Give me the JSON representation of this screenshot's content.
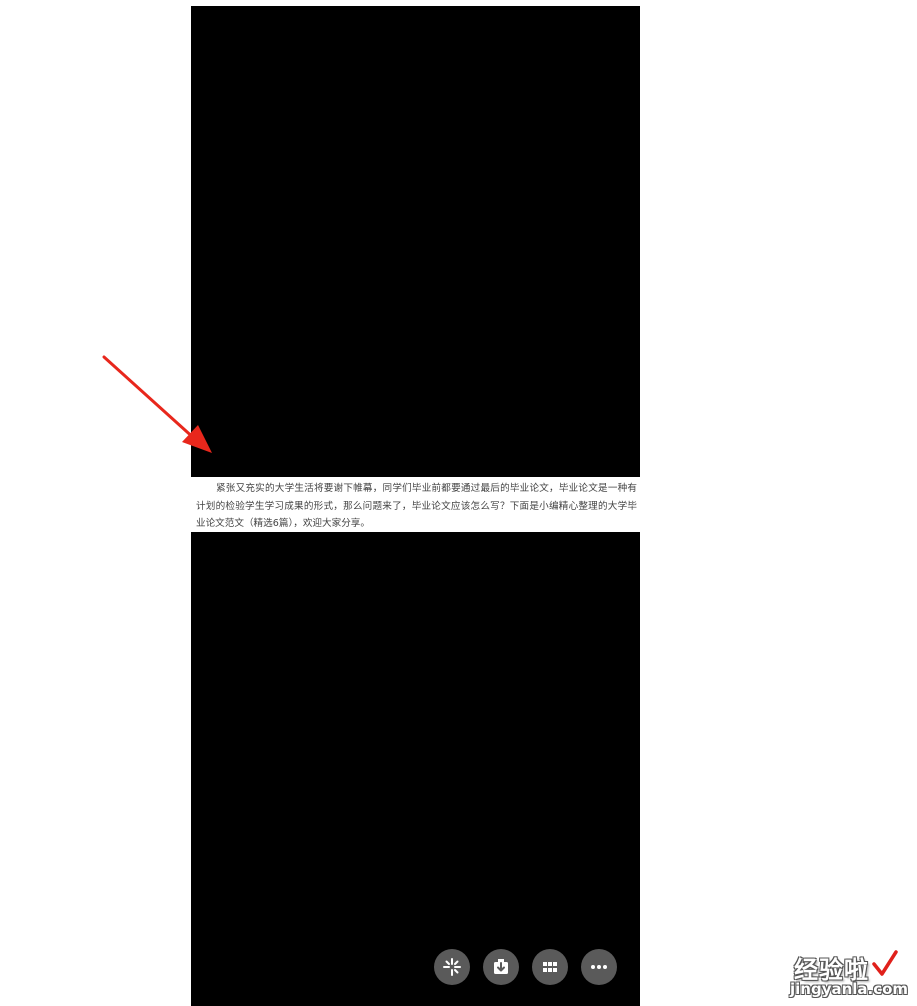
{
  "article": {
    "paragraph": "紧张又充实的大学生活将要谢下帷幕，同学们毕业前都要通过最后的毕业论文，毕业论文是一种有计划的检验学生学习成果的形式，那么问题来了，毕业论文应该怎么写？下面是小编精心整理的大学毕业论文范文（精选6篇），欢迎大家分享。"
  },
  "toolbar": {
    "buttons": [
      {
        "icon": "sparkle-icon"
      },
      {
        "icon": "download-icon"
      },
      {
        "icon": "grid-icon"
      },
      {
        "icon": "more-icon"
      }
    ]
  },
  "annotation": {
    "arrow_color": "#e8271c"
  },
  "watermark": {
    "title": "经验啦",
    "url": "jingyanla.com",
    "check_color": "#e0201b"
  }
}
